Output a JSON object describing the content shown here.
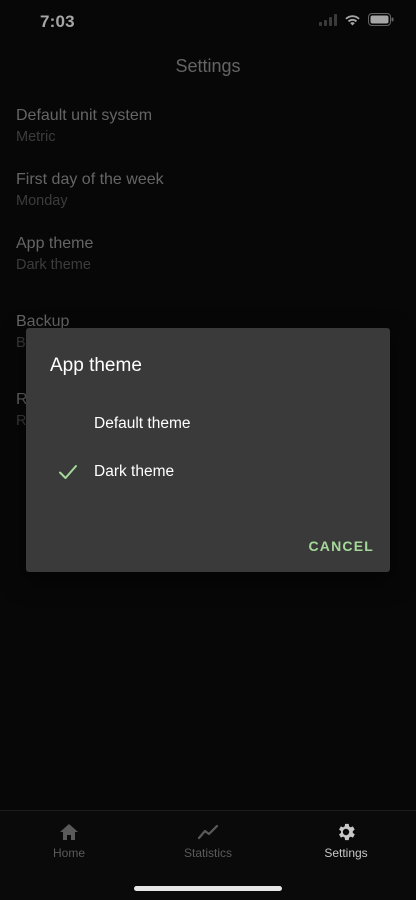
{
  "status_bar": {
    "time": "7:03"
  },
  "header": {
    "title": "Settings"
  },
  "settings": {
    "items": [
      {
        "label": "Default unit system",
        "value": "Metric"
      },
      {
        "label": "First day of the week",
        "value": "Monday"
      },
      {
        "label": "App theme",
        "value": "Dark theme"
      },
      {
        "label": "Backup",
        "value": "B"
      },
      {
        "label": "R",
        "value": "R"
      }
    ]
  },
  "dialog": {
    "title": "App theme",
    "options": [
      {
        "label": "Default theme",
        "selected": false
      },
      {
        "label": "Dark theme",
        "selected": true
      }
    ],
    "cancel_label": "CANCEL",
    "accent_color": "#a5d99a"
  },
  "tab_bar": {
    "tabs": [
      {
        "label": "Home",
        "icon": "home-icon",
        "active": false
      },
      {
        "label": "Statistics",
        "icon": "chart-line-icon",
        "active": false
      },
      {
        "label": "Settings",
        "icon": "gear-icon",
        "active": true
      }
    ],
    "active_color": "#c8c8c8",
    "inactive_color": "#5a5a5a"
  }
}
